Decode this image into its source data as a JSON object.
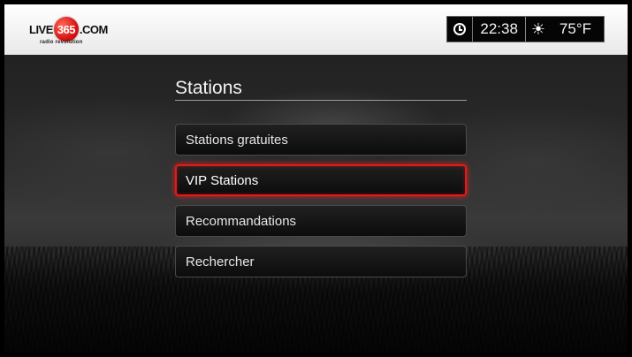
{
  "header": {
    "logo": {
      "prefix": "LIVE",
      "number": "365",
      "suffix": ".COM",
      "tagline": "radio revolution"
    },
    "status": {
      "clock_icon": "clock-icon",
      "time": "22:38",
      "weather_icon": "sun-icon",
      "temperature": "75°F"
    }
  },
  "menu": {
    "title": "Stations",
    "items": [
      {
        "label": "Stations gratuites",
        "selected": false
      },
      {
        "label": "VIP Stations",
        "selected": true
      },
      {
        "label": "Recommandations",
        "selected": false
      },
      {
        "label": "Rechercher",
        "selected": false
      }
    ]
  },
  "colors": {
    "selection_border": "#e01b1b",
    "header_background": "#ffffff",
    "logo_red": "#d91414"
  }
}
